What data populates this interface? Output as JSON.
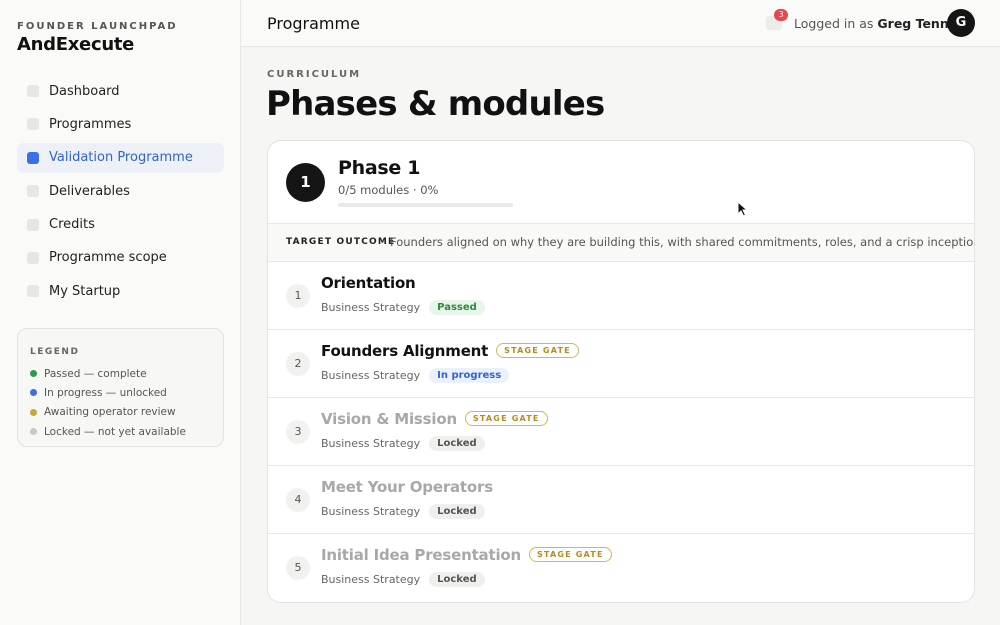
{
  "brand": {
    "kicker": "FOUNDER LAUNCHPAD",
    "name": "AndExecute"
  },
  "sidebar": {
    "items": [
      {
        "label": "Dashboard",
        "active": false
      },
      {
        "label": "Programmes",
        "active": false
      },
      {
        "label": "Validation Programme",
        "active": true
      },
      {
        "label": "Deliverables",
        "active": false
      },
      {
        "label": "Credits",
        "active": false
      },
      {
        "label": "Programme scope",
        "active": false
      },
      {
        "label": "My Startup",
        "active": false
      }
    ]
  },
  "legend": {
    "title": "LEGEND",
    "items": [
      {
        "label": "Passed — complete",
        "color": "#2e9a45"
      },
      {
        "label": "In progress — unlocked",
        "color": "#3b6fe6"
      },
      {
        "label": "Awaiting operator review",
        "color": "#c9a53a"
      },
      {
        "label": "Locked — not yet available",
        "color": "#c8c8c6"
      }
    ]
  },
  "topbar": {
    "title": "Programme",
    "notifications": "3",
    "login_prefix": "Logged in as",
    "user_name": "Greg Tennant",
    "avatar_initial": "G"
  },
  "main": {
    "kicker": "CURRICULUM",
    "title": "Phases & modules"
  },
  "phase": {
    "number": "1",
    "title": "Phase 1",
    "meta": "0/5 modules · 0%",
    "progress": 0,
    "outcome_label": "TARGET OUTCOME",
    "outcome_text": "Founders aligned on why they are building this, with shared commitments, roles, and a crisp inception thesis."
  },
  "modules": [
    {
      "number": "1",
      "title": "Orientation",
      "category": "Business Strategy",
      "status": "Passed",
      "status_kind": "passed",
      "stage_gate": false,
      "locked": false
    },
    {
      "number": "2",
      "title": "Founders Alignment",
      "category": "Business Strategy",
      "status": "In progress",
      "status_kind": "progress",
      "stage_gate": true,
      "locked": false
    },
    {
      "number": "3",
      "title": "Vision & Mission",
      "category": "Business Strategy",
      "status": "Locked",
      "status_kind": "locked",
      "stage_gate": true,
      "locked": true
    },
    {
      "number": "4",
      "title": "Meet Your Operators",
      "category": "Business Strategy",
      "status": "Locked",
      "status_kind": "locked",
      "stage_gate": false,
      "locked": true
    },
    {
      "number": "5",
      "title": "Initial Idea Presentation",
      "category": "Business Strategy",
      "status": "Locked",
      "status_kind": "locked",
      "stage_gate": true,
      "locked": true
    }
  ],
  "stage_gate_label": "STAGE GATE"
}
